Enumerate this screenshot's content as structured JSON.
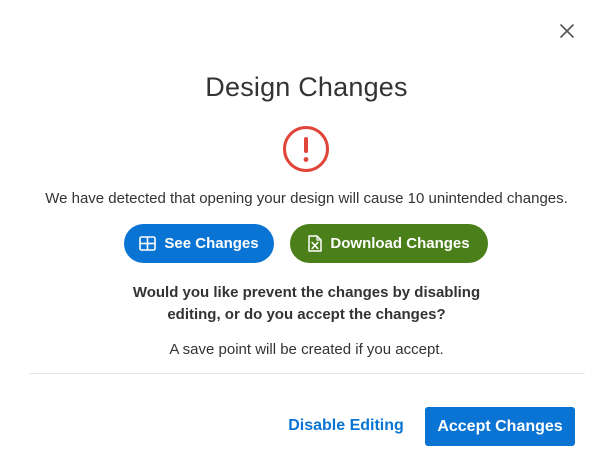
{
  "dialog": {
    "title": "Design Changes",
    "message": "We have detected that opening your design will cause 10 unintended changes.",
    "question_line1": "Would you like prevent the changes by disabling",
    "question_line2": "editing, or do you accept the changes?",
    "savepoint_note": "A save point will be created if you accept."
  },
  "buttons": {
    "see_changes": "See Changes",
    "download_changes": "Download Changes",
    "disable_editing": "Disable Editing",
    "accept_changes": "Accept Changes"
  },
  "icons": {
    "close": "close-icon",
    "warning": "exclamation-circle-icon",
    "see_changes": "table-grid-icon",
    "download_changes": "excel-file-icon"
  },
  "colors": {
    "primary_blue": "#0a74d4",
    "download_green": "#4a7f1a",
    "warning_red": "#e0453a",
    "text": "#333333",
    "divider": "#e6e6e6"
  }
}
